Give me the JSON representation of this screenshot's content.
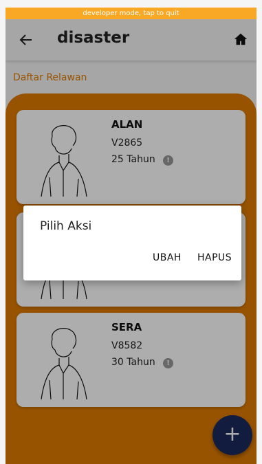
{
  "dev_banner": "developer mode, tap to quit",
  "appbar": {
    "title": "disaster",
    "back_icon": "arrow-left-icon",
    "home_icon": "home-icon"
  },
  "section_title": "Daftar Relawan",
  "volunteers": [
    {
      "name": "ALAN",
      "code": "V2865",
      "age": "25 Tahun"
    },
    {
      "name": "",
      "code": "",
      "age": ""
    },
    {
      "name": "SERA",
      "code": "V8582",
      "age": "30 Tahun"
    }
  ],
  "dialog": {
    "title": "Pilih Aksi",
    "edit_label": "UBAH",
    "delete_label": "HAPUS"
  },
  "fab": {
    "label": "+",
    "icon": "plus-icon"
  },
  "colors": {
    "accent": "#e07b00",
    "fab": "#1a2a5e",
    "dev_banner": "#f9a825"
  }
}
